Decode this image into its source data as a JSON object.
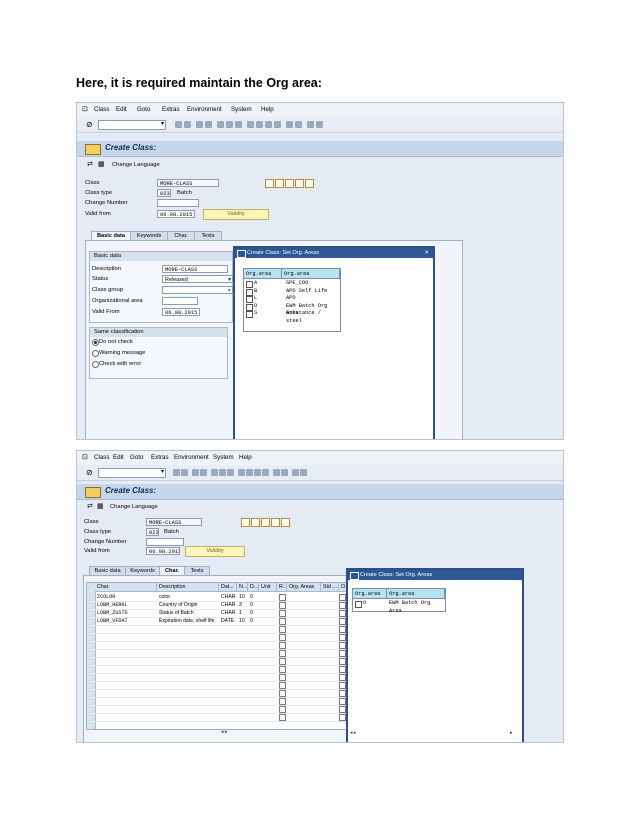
{
  "heading": "Here, it is required maintain the Org area:",
  "menu": [
    "Class",
    "Edit",
    "Goto",
    "Extras",
    "Environment",
    "System",
    "Help"
  ],
  "screen_title": "Create Class:",
  "change_language": "Change Language",
  "header_fields": {
    "class_label": "Class",
    "class_value": "MORE-CLASS",
    "class_type_label": "Class type",
    "class_type_value": "023",
    "class_type_text": "Batch",
    "change_number_label": "Change Number",
    "valid_from_label": "Valid from",
    "valid_from_value": "06.08.2015",
    "validity_button": "Validity"
  },
  "tabs": [
    "Basic data",
    "Keywords",
    "Char.",
    "Texts"
  ],
  "basic_data": {
    "group_title": "Basic data",
    "description_label": "Description",
    "description_value": "MORE-CLASS",
    "status_label": "Status",
    "status_value": "Released",
    "class_group_label": "Class group",
    "org_area_label": "Organizational area",
    "valid_from_label": "Valid From",
    "valid_from_value": "06.08.2015"
  },
  "same_classification": {
    "title": "Same classification",
    "options": [
      "Do not check",
      "Warning message",
      "Check with error"
    ],
    "selected": 0
  },
  "popup1": {
    "title": "Create Class: Set Org. Areas",
    "col1": "Org.area",
    "col2": "Org.area",
    "rows": [
      {
        "code": "A",
        "text": "SPE_COO"
      },
      {
        "code": "B",
        "text": "APO Self Life"
      },
      {
        "code": "L",
        "text": "APO"
      },
      {
        "code": "O",
        "text": "EWM Batch Org Area"
      },
      {
        "code": "S",
        "text": "Substance / steel"
      }
    ]
  },
  "char_table": {
    "headers": [
      "Char.",
      "Description",
      "Dat...",
      "N...",
      "D...",
      "Unit",
      "R...",
      "Org. Areas",
      "Std ...",
      "O..."
    ],
    "rows": [
      {
        "char": "ZCOLOR",
        "desc": "color",
        "type": "CHAR",
        "n": "10",
        "d": "0"
      },
      {
        "char": "LOBM_HERKL",
        "desc": "Country of Origin",
        "type": "CHAR",
        "n": "3",
        "d": "0"
      },
      {
        "char": "LOBM_ZUSTD",
        "desc": "Status of Batch",
        "type": "CHAR",
        "n": "1",
        "d": "0"
      },
      {
        "char": "LOBM_VFDAT",
        "desc": "Expiration date, shelf life",
        "type": "DATE",
        "n": "10",
        "d": "0"
      }
    ]
  },
  "popup2": {
    "title": "Create Class: Set Org. Areas",
    "col1": "Org.area",
    "col2": "Org.area",
    "rows": [
      {
        "code": "O",
        "text": "EWM Batch Org Area"
      }
    ]
  }
}
